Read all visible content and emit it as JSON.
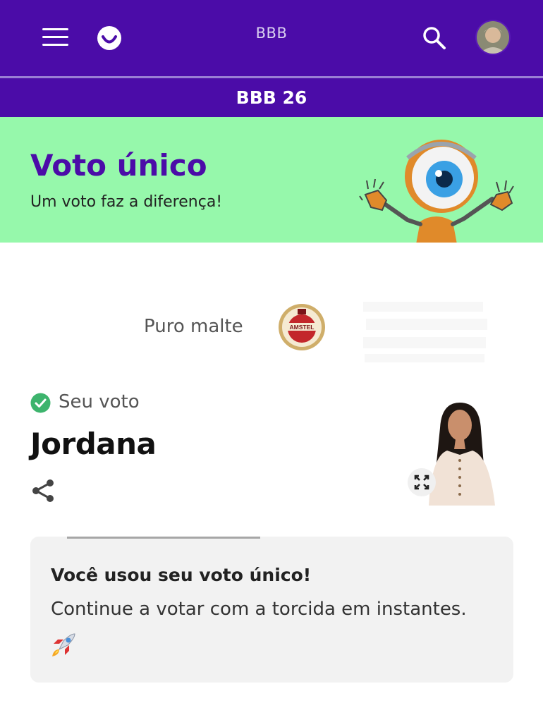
{
  "header": {
    "title": "BBB",
    "menu_icon": "hamburger-menu-icon",
    "logo_icon": "smile-logo-icon",
    "search_icon": "search-icon",
    "avatar_icon": "user-avatar"
  },
  "subheader": {
    "label": "BBB 26"
  },
  "banner": {
    "title": "Voto único",
    "subtitle": "Um voto faz a diferença!",
    "background": "#96f8ab",
    "title_color": "#4b0ca8"
  },
  "sponsor": {
    "text": "Puro malte",
    "badge_text": "AMSTEL"
  },
  "vote": {
    "label": "Seu voto",
    "name": "Jordana",
    "check_color": "#3db46d"
  },
  "card": {
    "title": "Você usou seu voto único!",
    "text": "Continue a votar com a torcida em instantes.",
    "icon": "rocket-icon"
  },
  "colors": {
    "brand": "#4b0ca8",
    "banner": "#96f8ab"
  }
}
